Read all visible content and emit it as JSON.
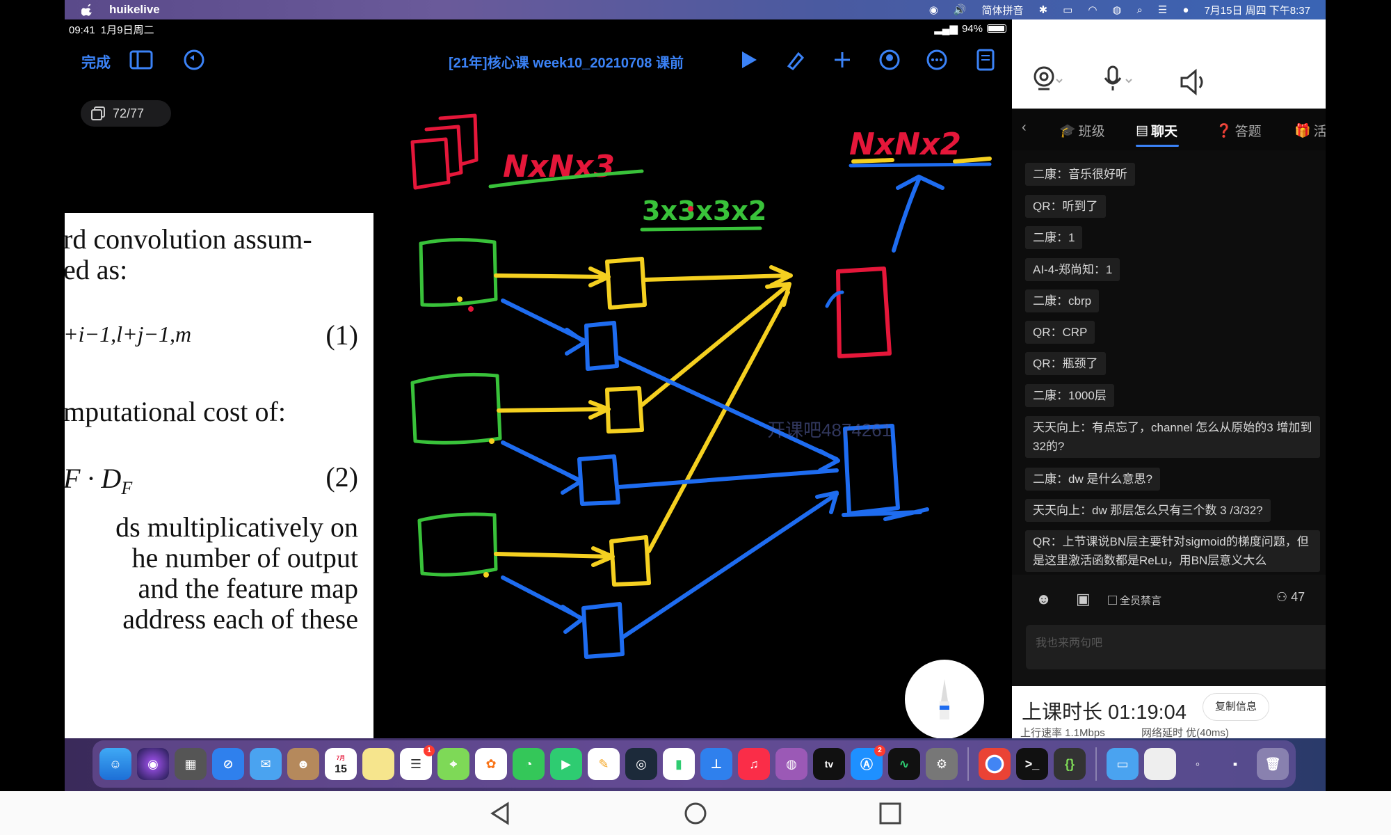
{
  "menubar": {
    "app_name": "huikelive",
    "input_method": "简体拼音",
    "datetime": "7月15日 周四 下午8:37"
  },
  "ipad_status": {
    "time": "09:41",
    "date": "1月9日周二",
    "battery": "94%"
  },
  "toolbar": {
    "done_label": "完成",
    "title": "[21年]核心课 week10_20210708 课前"
  },
  "page_indicator": "72/77",
  "paper": {
    "lines": [
      "rd convolution assum-",
      "ed as:",
      "(1)",
      "mputational cost of:",
      "(2)",
      "ds multiplicatively on",
      "he number of output",
      "and the feature map",
      "address each of these"
    ],
    "formula1": "+i−1,l+j−1,m",
    "formula2": "F · D",
    "formula2_sub": "F"
  },
  "annotations": {
    "input_label": "NxNx3",
    "kernel_label": "3x3x3x2",
    "output_label": "NxNx2"
  },
  "watermark": "开课吧4874261",
  "panel": {
    "tabs": [
      {
        "label": "班级",
        "icon": "graduation-cap-icon"
      },
      {
        "label": "聊天",
        "icon": "chat-icon"
      },
      {
        "label": "答题",
        "icon": "question-icon"
      },
      {
        "label": "活",
        "icon": "gift-icon"
      }
    ],
    "messages": [
      "二康：音乐很好听",
      "QR：听到了",
      "二康：1",
      "AI-4-郑尚知：1",
      "二康：cbrp",
      "QR：CRP",
      "QR：瓶颈了",
      "二康：1000层",
      "天天向上：有点忘了，channel 怎么从原始的3 增加到32的?",
      "二康：dw 是什么意思?",
      "天天向上：dw 那层怎么只有三个数 3 /3/32?",
      "QR：上节课说BN层主要针对sigmoid的梯度问题，但是这里激活函数都是ReLu，用BN层意义大么"
    ],
    "mute_all_label": "全员禁言",
    "online_count": "47",
    "input_placeholder": "我也来两句吧",
    "duration_label": "上课时长 01:19:04",
    "copy_button": "复制信息",
    "upload_rate": "上行速率  1.1Mbps",
    "latency": "网络延时  优(40ms)"
  },
  "dock": {
    "calendar_day": "15",
    "calendar_month": "7月",
    "badge_reminders": "1",
    "badge_appstore": "2",
    "tv_label": "tv"
  },
  "colors": {
    "accent": "#3b82f6",
    "ink_red": "#e5173a",
    "ink_yellow": "#f5d020",
    "ink_green": "#39c23a",
    "ink_blue": "#1e6cf0"
  }
}
